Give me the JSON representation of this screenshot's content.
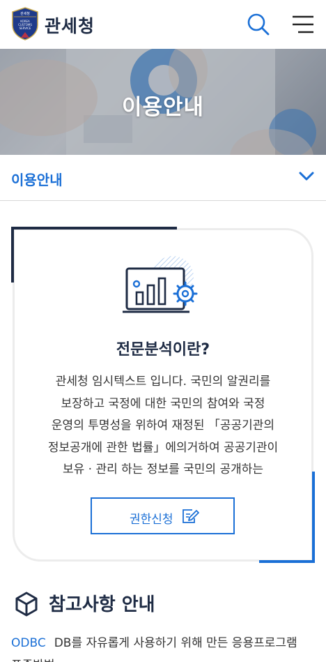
{
  "header": {
    "brand": "관세청",
    "logo_text": [
      "관세청",
      "KOREA",
      "CUSTOMS",
      "SERVICE"
    ],
    "search_icon": "search-icon",
    "menu_icon": "hamburger-menu-icon"
  },
  "banner": {
    "title": "이용안내"
  },
  "subnav": {
    "label": "이용안내",
    "icon": "chevron-down-icon"
  },
  "card": {
    "icon": "analytics-monitor-icon",
    "title": "전문분석이란?",
    "body_lines": [
      "관세청 임시텍스트 입니다. 국민의 알권리를",
      "보장하고 국정에 대한 국민의 참여와 국정",
      "운영의 투명성을 위하여 재정된 「공공기관의",
      "정보공개에 관한 법률」에의거하여 공공기관이",
      "보유 · 관리 하는 정보를 국민의 공개하는"
    ],
    "button_label": "권한신청",
    "button_icon": "edit-document-icon"
  },
  "reference": {
    "icon": "cube-icon",
    "title": "참고사항 안내",
    "term": "ODBC",
    "desc_line1": "DB를 자유롭게 사용하기 위해 만든 응용프로그램",
    "desc_line2": "표준방법"
  },
  "colors": {
    "primary_blue": "#1a6fd6",
    "navy": "#1e2b44",
    "border_gray": "#ececec"
  }
}
